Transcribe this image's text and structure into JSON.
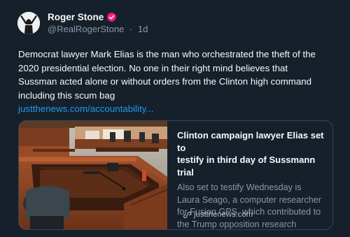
{
  "author": {
    "display_name": "Roger Stone",
    "handle": "@RealRogerStone",
    "separator": "·",
    "age": "1d",
    "avatar_icon": "raised-arms-figure",
    "badge_icon": "verified-check-badge",
    "badge_color": "#f91880"
  },
  "tweet": {
    "line1": "Democrat lawyer Mark Elias is the man who orchestrated the theft of the",
    "line2": "2020 presidential election. No one in their right mind believes that",
    "line3": "Sussman acted alone or without orders from the Clinton high command",
    "line4": "including this scum bag",
    "link": "justthenews.com/accountability..."
  },
  "card": {
    "title_line1": "Clinton campaign lawyer Elias set to",
    "title_line2": "testify in third day of Sussmann trial",
    "desc_line1": "Also set to testify Wednesday is",
    "desc_line2": "Laura Seago, a computer researcher",
    "desc_line3": "for Fusion GPS, which contributed to",
    "desc_line4": "the Trump opposition research",
    "domain": "justthenews.com",
    "domain_icon": "link-icon",
    "image_subject": "courtroom-witness-stand"
  },
  "colors": {
    "background": "#15202b",
    "link": "#1d9bf0",
    "muted": "#8b98a5",
    "border": "#38444d"
  }
}
